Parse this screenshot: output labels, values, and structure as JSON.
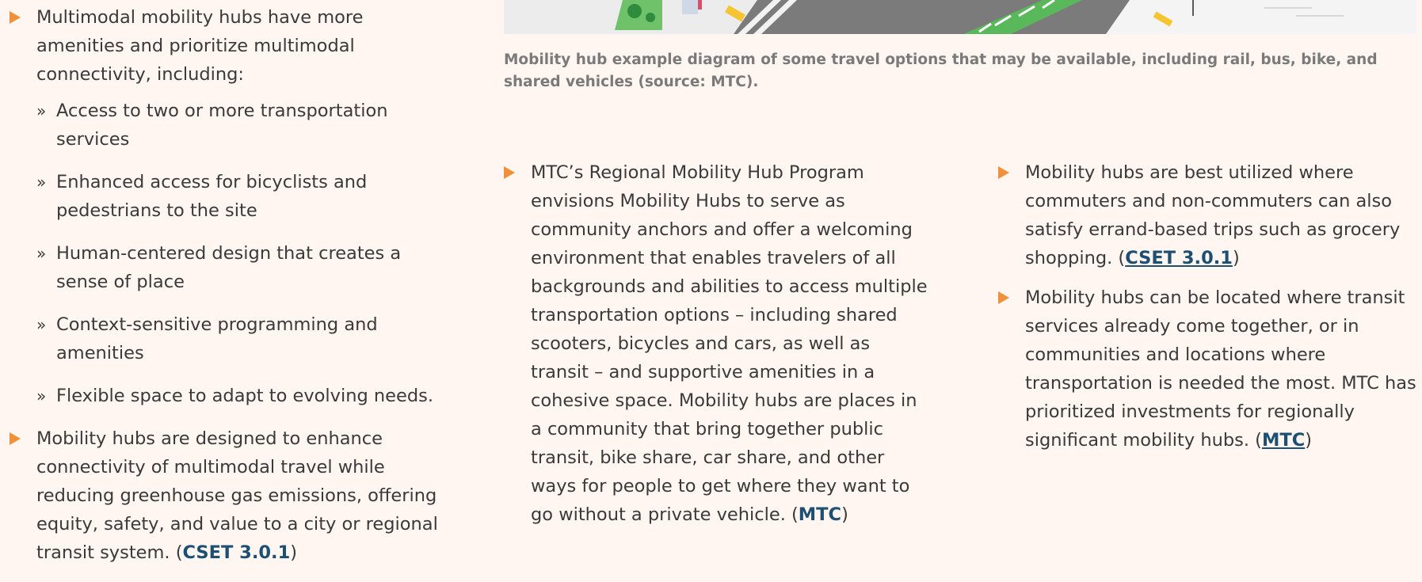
{
  "left": {
    "bullet1": {
      "text": "Multimodal mobility hubs have more amenities and prioritize multimodal connectivity, including:",
      "sub": [
        "Access to two or more transportation services",
        "Enhanced access for bicyclists and pedestrians to the site",
        "Human-centered design that creates a sense of place",
        "Context-sensitive programming and amenities",
        "Flexible space to adapt to evolving needs."
      ]
    },
    "bullet2": {
      "text": "Mobility hubs are designed to enhance connectivity of multimodal travel while reducing greenhouse gas emissions, offering equity, safety, and value to a city or regional transit system. (",
      "link": "CSET 3.0.1",
      "after": ")"
    }
  },
  "figure": {
    "caption": "Mobility hub example diagram of some travel options that may be available, including rail, bus, bike, and shared vehicles (source: MTC)."
  },
  "middle": {
    "text": "MTC’s Regional Mobility Hub Program envisions Mobility Hubs to serve as community anchors and offer a welcoming environment that enables travelers of all backgrounds and abilities to access multiple transportation options – including shared scooters, bicycles and cars, as well as transit – and supportive amenities in a cohesive space. Mobility hubs are places in a community that bring together public transit, bike share, car share, and other ways for people to get where they want to go without a private vehicle. (",
    "link": "MTC",
    "after": ")"
  },
  "right": {
    "bullet1": {
      "text": "Mobility hubs are best utilized where commuters and non-commuters can also satisfy errand-based trips such as grocery shopping. (",
      "link": "CSET 3.0.1",
      "after": ")"
    },
    "bullet2": {
      "text": "Mobility hubs can be located where transit services already come together, or in communities and locations where transportation is needed the most. MTC has prioritized investments for regionally significant mobility hubs. (",
      "link": "MTC",
      "after": ")"
    }
  },
  "colors": {
    "background": "#fff5f1",
    "bullet": "#f0913a",
    "link": "#1d4f73",
    "caption": "#7a7a7a"
  }
}
